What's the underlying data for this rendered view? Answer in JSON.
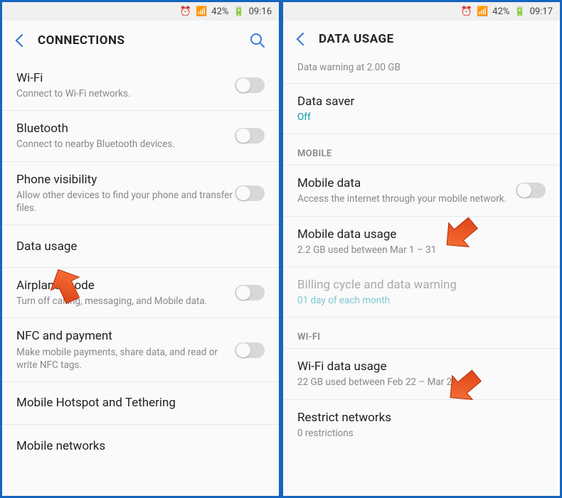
{
  "left": {
    "status": {
      "battery_pct": "42%",
      "time": "09:16"
    },
    "header": {
      "title": "CONNECTIONS"
    },
    "rows": {
      "wifi": {
        "title": "Wi-Fi",
        "sub": "Connect to Wi-Fi networks."
      },
      "bluetooth": {
        "title": "Bluetooth",
        "sub": "Connect to nearby Bluetooth devices."
      },
      "phone_vis": {
        "title": "Phone visibility",
        "sub": "Allow other devices to find your phone and transfer files."
      },
      "data_usage": {
        "title": "Data usage"
      },
      "airplane": {
        "title": "Airplane mode",
        "sub": "Turn off calling, messaging, and Mobile data."
      },
      "nfc": {
        "title": "NFC and payment",
        "sub": "Make mobile payments, share data, and read or write NFC tags."
      },
      "hotspot": {
        "title": "Mobile Hotspot and Tethering"
      },
      "networks": {
        "title": "Mobile networks"
      }
    }
  },
  "right": {
    "status": {
      "battery_pct": "42%",
      "time": "09:17"
    },
    "header": {
      "title": "DATA USAGE"
    },
    "cut_top": "Data warning at 2.00 GB",
    "rows": {
      "data_saver": {
        "title": "Data saver",
        "sub": "Off"
      },
      "section_mobile": "MOBILE",
      "mobile_data": {
        "title": "Mobile data",
        "sub": "Access the internet through your mobile network."
      },
      "mobile_data_usage": {
        "title": "Mobile data usage",
        "sub": "2.2 GB used between Mar 1 – 31"
      },
      "billing": {
        "title": "Billing cycle and data warning",
        "sub": "01 day of each month"
      },
      "section_wifi": "WI-FI",
      "wifi_data_usage": {
        "title": "Wi-Fi data usage",
        "sub": "22 GB used between Feb 22 – Mar 21"
      },
      "restrict": {
        "title": "Restrict networks",
        "sub": "0 restrictions"
      }
    }
  },
  "colors": {
    "arrow": "#f04e23"
  }
}
